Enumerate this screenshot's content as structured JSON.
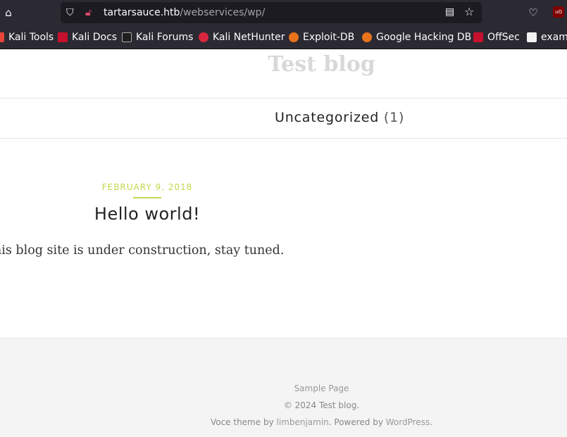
{
  "browser": {
    "url_host": "tartarsauce.htb",
    "url_path": "/webservices/wp/",
    "bookmarks": [
      {
        "label": "Kali Tools",
        "color": "#e8463a"
      },
      {
        "label": "Kali Docs",
        "color": "#c8102e"
      },
      {
        "label": "Kali Forums",
        "color": "#1e1e1e"
      },
      {
        "label": "Kali NetHunter",
        "color": "#d7263d"
      },
      {
        "label": "Exploit-DB",
        "color": "#e8731a"
      },
      {
        "label": "Google Hacking DB",
        "color": "#e8731a"
      },
      {
        "label": "OffSec",
        "color": "#c8102e"
      },
      {
        "label": "examp",
        "color": "#f2f2f2"
      }
    ]
  },
  "site": {
    "title": "Test blog",
    "nav_item": "Uncategorized",
    "nav_count": "(1)"
  },
  "post": {
    "date": "FEBRUARY 9, 2018",
    "title": "Hello world!",
    "body": "his blog site is under construction, stay tuned."
  },
  "footer": {
    "sample_page": "Sample Page",
    "copyright_prefix": "© 2024 ",
    "copyright_link": "Test blog",
    "copyright_suffix": ".",
    "theme_prefix": "Voce theme by ",
    "theme_author": "limbenjamin",
    "powered_prefix": ". Powered by ",
    "powered_link": "WordPress",
    "powered_suffix": "."
  },
  "colors": {
    "accent": "#c5d64b",
    "chrome_bg": "#2b2a33",
    "urlbar_bg": "#1c1b22"
  }
}
